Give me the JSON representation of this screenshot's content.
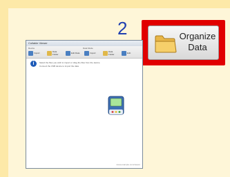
{
  "step": {
    "number": "2"
  },
  "organize": {
    "label": "Organize\nData",
    "icon": "folder-icon"
  },
  "window": {
    "title": "Collabie Viewer",
    "groups": {
      "left": "Device",
      "right": "Data Mode"
    },
    "toolbar": [
      {
        "label": "Import",
        "icon": "import-icon",
        "color": "#4a7fc1"
      },
      {
        "label": "Data Folder",
        "icon": "folder-icon",
        "color": "#e0b84a"
      },
      {
        "label": "Edit Data",
        "icon": "edit-icon",
        "color": "#4a7fc1"
      },
      {
        "label": "Import",
        "icon": "import-icon",
        "color": "#4a7fc1"
      },
      {
        "label": "Data Folder",
        "icon": "folder-icon",
        "color": "#e0b84a"
      },
      {
        "label": "Edit",
        "icon": "edit-icon",
        "color": "#4a7fc1"
      }
    ],
    "info_lines": [
      "Select the files you wish to import or drag the files from the device.",
      "Connect the USB device to import the data"
    ],
    "status": "www.example.com/viewer"
  },
  "colors": {
    "highlight": "#e10000",
    "step_number": "#1f3fb0",
    "background": "#fde9a8"
  }
}
